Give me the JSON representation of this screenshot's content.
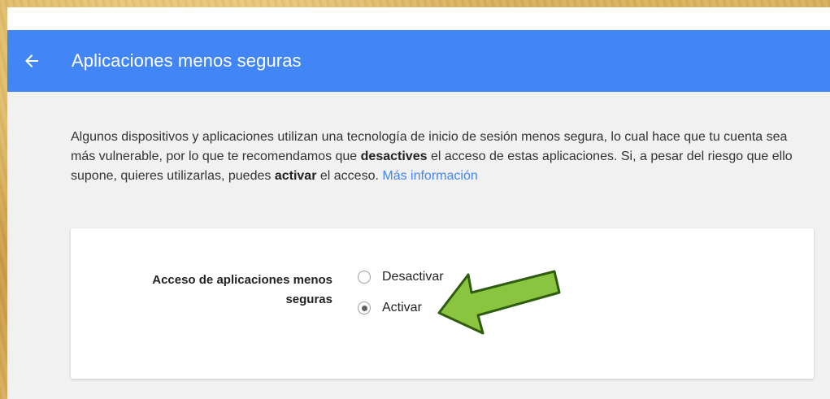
{
  "header": {
    "title": "Aplicaciones menos seguras",
    "back_icon": "arrow-back-icon",
    "color": "#4285f4"
  },
  "description": {
    "part1": "Algunos dispositivos y aplicaciones utilizan una tecnología de inicio de sesión menos segura, lo cual hace que tu cuenta sea más vulnerable, por lo que te recomendamos que ",
    "bold1": "desactives",
    "part2": " el acceso de estas aplicaciones. Si, a pesar del riesgo que ello supone, quieres utilizarlas, puedes ",
    "bold2": "activar",
    "part3": " el acceso. ",
    "link": "Más información"
  },
  "setting": {
    "label": "Acceso de aplicaciones menos seguras",
    "options": [
      {
        "label": "Desactivar",
        "selected": false
      },
      {
        "label": "Activar",
        "selected": true
      }
    ]
  },
  "annotation": {
    "icon": "green-arrow-icon",
    "color": "#8bc53f"
  }
}
